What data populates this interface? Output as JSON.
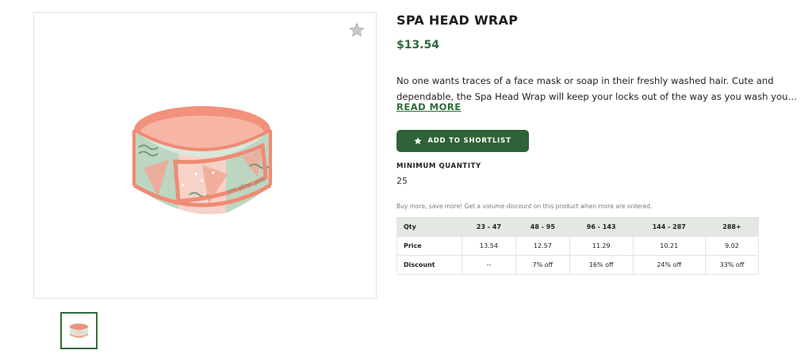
{
  "product": {
    "title": "SPA HEAD WRAP",
    "price": "$13.54",
    "description_line1": "No one wants traces of a face mask or soap in their freshly washed hair. Cute and",
    "description_line2": "dependable, the Spa Head Wrap will keep your locks out of the way as you wash you…",
    "read_more": "READ MORE",
    "image_text": "you glow, girl!"
  },
  "actions": {
    "shortlist_label": "ADD TO SHORTLIST"
  },
  "minimum_quantity": {
    "label": "MINIMUM QUANTITY",
    "value": "25"
  },
  "pricing": {
    "note": "Buy more, save more! Get a volume discount on this product when more are ordered.",
    "header": [
      "Qty",
      "23 - 47",
      "48 - 95",
      "96 - 143",
      "144 - 287",
      "288+"
    ],
    "rows": [
      [
        "Price",
        "13.54",
        "12.57",
        "11.29",
        "10.21",
        "9.02"
      ],
      [
        "Discount",
        "--",
        "7% off",
        "16% off",
        "24% off",
        "33% off"
      ]
    ]
  },
  "colors": {
    "accent_green": "#2f6b3a",
    "button_green": "#2f6236",
    "table_header_bg": "#e4e8e2",
    "wrap_pink": "#f4a08c",
    "wrap_mint": "#cfe2d2"
  },
  "icons": {
    "favorite": "star-icon",
    "shortlist": "star-icon"
  }
}
